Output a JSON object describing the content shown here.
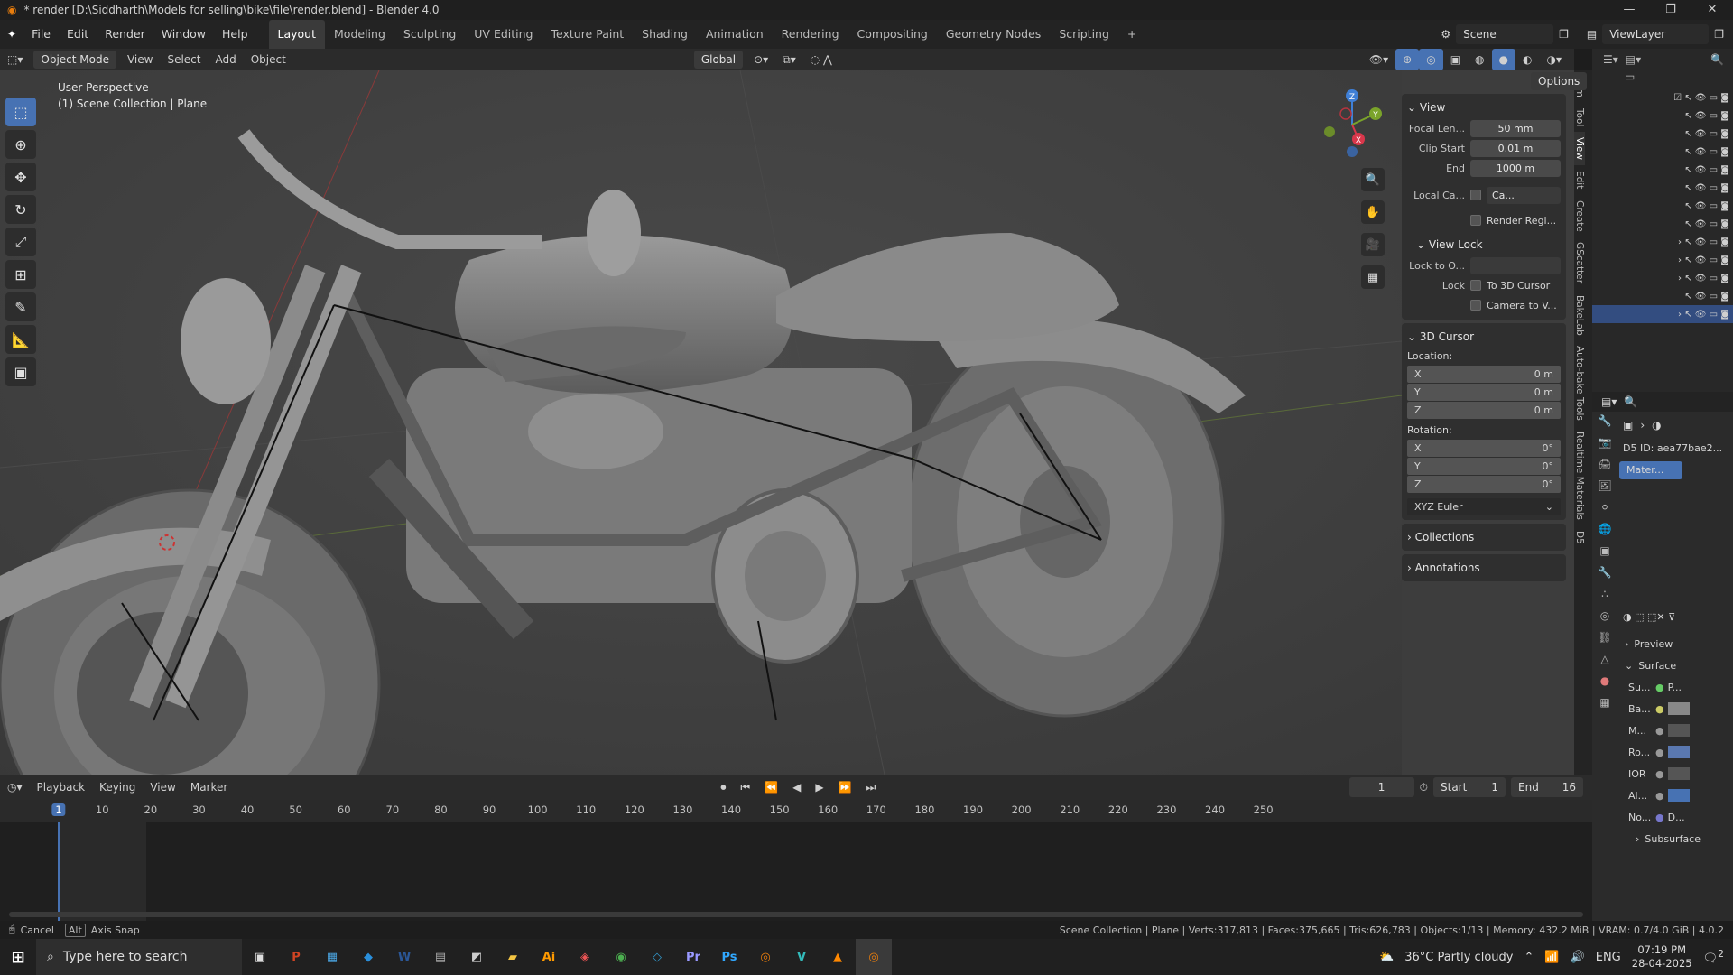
{
  "titlebar": {
    "title": "* render [D:\\Siddharth\\Models for selling\\bike\\file\\render.blend] - Blender 4.0",
    "min": "—",
    "max": "❐",
    "close": "✕"
  },
  "menu": [
    "File",
    "Edit",
    "Render",
    "Window",
    "Help"
  ],
  "workspaces": [
    "Layout",
    "Modeling",
    "Sculpting",
    "UV Editing",
    "Texture Paint",
    "Shading",
    "Animation",
    "Rendering",
    "Compositing",
    "Geometry Nodes",
    "Scripting"
  ],
  "workspace_add": "+",
  "scene": {
    "name": "Scene",
    "view_layer": "ViewLayer"
  },
  "viewport_header": {
    "mode": "Object Mode",
    "items": [
      "View",
      "Select",
      "Add",
      "Object"
    ],
    "orientation": "Global",
    "options": "Options"
  },
  "viewport_overlay": {
    "line1": "User Perspective",
    "line2": "(1) Scene Collection | Plane"
  },
  "gizmo": {
    "z": "Z",
    "y": "Y",
    "x": "X"
  },
  "npanel": {
    "view": {
      "title": "View",
      "focal_label": "Focal Len...",
      "focal": "50 mm",
      "clip_start_label": "Clip Start",
      "clip_start": "0.01 m",
      "end_label": "End",
      "end": "1000 m",
      "local_camera_label": "Local Ca...",
      "local_camera": "Ca...",
      "render_region": "Render Regi..."
    },
    "view_lock": {
      "title": "View Lock",
      "lock_to_label": "Lock to O...",
      "lock_label": "Lock",
      "to_cursor": "To 3D Cursor",
      "camera": "Camera to V..."
    },
    "cursor": {
      "title": "3D Cursor",
      "location": "Location:",
      "rotation": "Rotation:",
      "loc": [
        {
          "a": "X",
          "v": "0 m"
        },
        {
          "a": "Y",
          "v": "0 m"
        },
        {
          "a": "Z",
          "v": "0 m"
        }
      ],
      "rot": [
        {
          "a": "X",
          "v": "0°"
        },
        {
          "a": "Y",
          "v": "0°"
        },
        {
          "a": "Z",
          "v": "0°"
        }
      ],
      "mode": "XYZ Euler"
    },
    "collections": "Collections",
    "annotations": "Annotations"
  },
  "sidetabs": [
    "Item",
    "Tool",
    "View",
    "Edit",
    "Create",
    "GScatter",
    "BakeLab",
    "Auto-bake Tools",
    "Realtime Materials",
    "D5"
  ],
  "properties": {
    "id": "D5 ID: aea77bae2...",
    "material": "Mater...",
    "preview": "Preview",
    "surface": "Surface",
    "rows": [
      {
        "l": "Su...",
        "v": "P..."
      },
      {
        "l": "Ba...",
        "v": ""
      },
      {
        "l": "M...",
        "v": ""
      },
      {
        "l": "Ro...",
        "v": ""
      },
      {
        "l": "IOR",
        "v": ""
      },
      {
        "l": "Al...",
        "v": ""
      },
      {
        "l": "No...",
        "v": "D..."
      }
    ],
    "subsurface": "Subsurface"
  },
  "timeline": {
    "menus": [
      "Playback",
      "Keying",
      "View",
      "Marker"
    ],
    "current_frame": "1",
    "start_label": "Start",
    "start": "1",
    "end_label": "End",
    "end": "16",
    "ticks": [
      "1",
      "10",
      "20",
      "30",
      "40",
      "50",
      "60",
      "70",
      "80",
      "90",
      "100",
      "110",
      "120",
      "130",
      "140",
      "150",
      "160",
      "170",
      "180",
      "190",
      "200",
      "210",
      "220",
      "230",
      "240",
      "250"
    ]
  },
  "status": {
    "left1": "Cancel",
    "left2": "Alt",
    "left3": "Axis Snap",
    "right": "Scene Collection | Plane | Verts:317,813 | Faces:375,665 | Tris:626,783 | Objects:1/13 | Memory: 432.2 MiB | VRAM: 0.7/4.0 GiB | 4.0.2"
  },
  "taskbar": {
    "search": "Type here to search",
    "weather": "36°C  Partly cloudy",
    "lang": "ENG",
    "time": "07:19 PM",
    "date": "28-04-2025",
    "notif": "2"
  },
  "colors": {
    "accent": "#4772b3",
    "viewport": "#3d3d3d",
    "panel": "#2f2f2f"
  }
}
